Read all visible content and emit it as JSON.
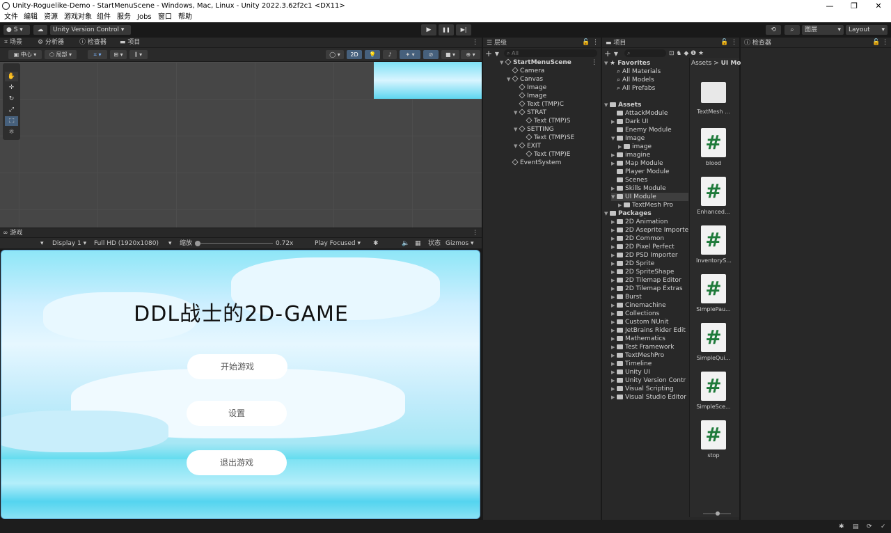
{
  "window_title": "Unity-Roguelike-Demo - StartMenuScene - Windows, Mac, Linux - Unity 2022.3.62f2c1 <DX11>",
  "window_controls": {
    "minimize": "—",
    "maximize": "❐",
    "close": "✕"
  },
  "menu": [
    "文件",
    "编辑",
    "资源",
    "游戏对象",
    "组件",
    "服务",
    "Jobs",
    "窗口",
    "帮助"
  ],
  "toolbar": {
    "account": "S",
    "version_control": "Unity Version Control",
    "play": "▶",
    "pause": "❚❚",
    "step": "▶|",
    "layers": "图层",
    "layout": "Layout"
  },
  "top_tabs": [
    "场景",
    "分析器",
    "检查器",
    "项目"
  ],
  "scene_toolbar": {
    "center": "中心",
    "local": "局部",
    "mode_2d": "2D"
  },
  "game_panel": {
    "tab": "游戏",
    "display": "Display 1",
    "resolution": "Full HD (1920x1080)",
    "scale_label": "缩放",
    "scale_value": "0.72x",
    "play_focused": "Play Focused",
    "stats": "状态",
    "gizmos": "Gizmos"
  },
  "game_view": {
    "title": "DDL战士的2D-GAME",
    "buttons": [
      "开始游戏",
      "设置",
      "退出游戏"
    ]
  },
  "hierarchy": {
    "tab": "层级",
    "search_placeholder": "All",
    "items": [
      {
        "label": "StartMenuScene",
        "depth": 0,
        "kind": "scene",
        "arrow": "▼"
      },
      {
        "label": "Camera",
        "depth": 1,
        "kind": "object",
        "arrow": ""
      },
      {
        "label": "Canvas",
        "depth": 1,
        "kind": "object",
        "arrow": "▼"
      },
      {
        "label": "Image",
        "depth": 2,
        "kind": "object",
        "arrow": ""
      },
      {
        "label": "Image",
        "depth": 2,
        "kind": "object",
        "arrow": ""
      },
      {
        "label": "Text (TMP)C",
        "depth": 2,
        "kind": "object",
        "arrow": ""
      },
      {
        "label": "STRAT",
        "depth": 2,
        "kind": "object",
        "arrow": "▼"
      },
      {
        "label": "Text (TMP)S",
        "depth": 3,
        "kind": "object",
        "arrow": ""
      },
      {
        "label": "SETTING",
        "depth": 2,
        "kind": "object",
        "arrow": "▼"
      },
      {
        "label": "Text (TMP)SE",
        "depth": 3,
        "kind": "object",
        "arrow": ""
      },
      {
        "label": "EXIT",
        "depth": 2,
        "kind": "object",
        "arrow": "▼"
      },
      {
        "label": "Text (TMP)E",
        "depth": 3,
        "kind": "object",
        "arrow": ""
      },
      {
        "label": "EventSystem",
        "depth": 1,
        "kind": "object",
        "arrow": ""
      }
    ]
  },
  "project": {
    "tab": "项目",
    "breadcrumb": [
      "Assets",
      "UI Mo"
    ],
    "tree": [
      {
        "label": "Favorites",
        "depth": 0,
        "kind": "star",
        "arrow": "▼"
      },
      {
        "label": "All Materials",
        "depth": 1,
        "kind": "search",
        "arrow": ""
      },
      {
        "label": "All Models",
        "depth": 1,
        "kind": "search",
        "arrow": ""
      },
      {
        "label": "All Prefabs",
        "depth": 1,
        "kind": "search",
        "arrow": ""
      },
      {
        "label": "",
        "depth": 0,
        "kind": "gap",
        "arrow": ""
      },
      {
        "label": "Assets",
        "depth": 0,
        "kind": "folder",
        "arrow": "▼"
      },
      {
        "label": "AttackModule",
        "depth": 1,
        "kind": "folder",
        "arrow": ""
      },
      {
        "label": "Dark UI",
        "depth": 1,
        "kind": "folder",
        "arrow": "▶"
      },
      {
        "label": "Enemy Module",
        "depth": 1,
        "kind": "folder",
        "arrow": ""
      },
      {
        "label": "Image",
        "depth": 1,
        "kind": "folder",
        "arrow": "▼"
      },
      {
        "label": "image",
        "depth": 2,
        "kind": "folder",
        "arrow": "▶"
      },
      {
        "label": "imagine",
        "depth": 1,
        "kind": "folder",
        "arrow": "▶"
      },
      {
        "label": "Map Module",
        "depth": 1,
        "kind": "folder",
        "arrow": "▶"
      },
      {
        "label": "Player Module",
        "depth": 1,
        "kind": "folder",
        "arrow": ""
      },
      {
        "label": "Scenes",
        "depth": 1,
        "kind": "folder",
        "arrow": ""
      },
      {
        "label": "Skills Module",
        "depth": 1,
        "kind": "folder",
        "arrow": "▶"
      },
      {
        "label": "UI Module",
        "depth": 1,
        "kind": "folder",
        "arrow": "▼",
        "selected": true
      },
      {
        "label": "TextMesh Pro",
        "depth": 2,
        "kind": "folder",
        "arrow": "▶"
      },
      {
        "label": "Packages",
        "depth": 0,
        "kind": "folder",
        "arrow": "▼"
      },
      {
        "label": "2D Animation",
        "depth": 1,
        "kind": "folder",
        "arrow": "▶"
      },
      {
        "label": "2D Aseprite Importe",
        "depth": 1,
        "kind": "folder",
        "arrow": "▶"
      },
      {
        "label": "2D Common",
        "depth": 1,
        "kind": "folder",
        "arrow": "▶"
      },
      {
        "label": "2D Pixel Perfect",
        "depth": 1,
        "kind": "folder",
        "arrow": "▶"
      },
      {
        "label": "2D PSD Importer",
        "depth": 1,
        "kind": "folder",
        "arrow": "▶"
      },
      {
        "label": "2D Sprite",
        "depth": 1,
        "kind": "folder",
        "arrow": "▶"
      },
      {
        "label": "2D SpriteShape",
        "depth": 1,
        "kind": "folder",
        "arrow": "▶"
      },
      {
        "label": "2D Tilemap Editor",
        "depth": 1,
        "kind": "folder",
        "arrow": "▶"
      },
      {
        "label": "2D Tilemap Extras",
        "depth": 1,
        "kind": "folder",
        "arrow": "▶"
      },
      {
        "label": "Burst",
        "depth": 1,
        "kind": "folder",
        "arrow": "▶"
      },
      {
        "label": "Cinemachine",
        "depth": 1,
        "kind": "folder",
        "arrow": "▶"
      },
      {
        "label": "Collections",
        "depth": 1,
        "kind": "folder",
        "arrow": "▶"
      },
      {
        "label": "Custom NUnit",
        "depth": 1,
        "kind": "folder",
        "arrow": "▶"
      },
      {
        "label": "JetBrains Rider Edit",
        "depth": 1,
        "kind": "folder",
        "arrow": "▶"
      },
      {
        "label": "Mathematics",
        "depth": 1,
        "kind": "folder",
        "arrow": "▶"
      },
      {
        "label": "Test Framework",
        "depth": 1,
        "kind": "folder",
        "arrow": "▶"
      },
      {
        "label": "TextMeshPro",
        "depth": 1,
        "kind": "folder",
        "arrow": "▶"
      },
      {
        "label": "Timeline",
        "depth": 1,
        "kind": "folder",
        "arrow": "▶"
      },
      {
        "label": "Unity UI",
        "depth": 1,
        "kind": "folder",
        "arrow": "▶"
      },
      {
        "label": "Unity Version Contr",
        "depth": 1,
        "kind": "folder",
        "arrow": "▶"
      },
      {
        "label": "Visual Scripting",
        "depth": 1,
        "kind": "folder",
        "arrow": "▶"
      },
      {
        "label": "Visual Studio Editor",
        "depth": 1,
        "kind": "folder",
        "arrow": "▶"
      }
    ],
    "assets": [
      {
        "label": "TextMesh ...",
        "kind": "folder"
      },
      {
        "label": "blood",
        "kind": "script"
      },
      {
        "label": "Enhanced...",
        "kind": "script"
      },
      {
        "label": "InventoryS...",
        "kind": "script"
      },
      {
        "label": "SimplePau...",
        "kind": "script"
      },
      {
        "label": "SimpleQui...",
        "kind": "script"
      },
      {
        "label": "SimpleSce...",
        "kind": "script"
      },
      {
        "label": "stop",
        "kind": "script"
      }
    ]
  },
  "inspector": {
    "tab": "检查器"
  }
}
